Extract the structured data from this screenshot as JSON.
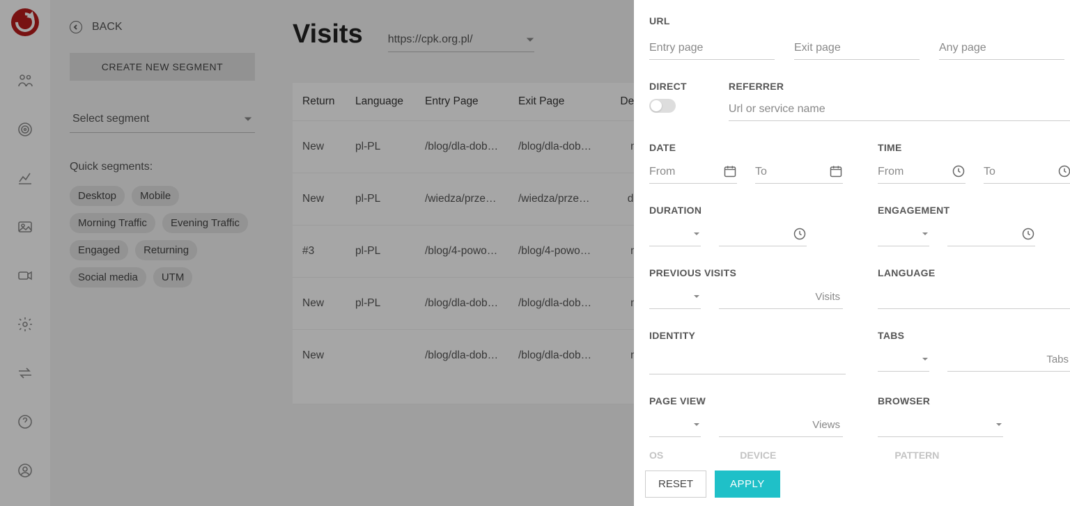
{
  "sidebar": {
    "back": "BACK",
    "create_segment": "CREATE NEW SEGMENT",
    "select_segment": "Select segment",
    "quick_segments_label": "Quick segments:",
    "chips": [
      "Desktop",
      "Mobile",
      "Morning Traffic",
      "Evening Traffic",
      "Engaged",
      "Returning",
      "Social media",
      "UTM"
    ]
  },
  "main": {
    "title": "Visits",
    "site": "https://cpk.org.pl/",
    "columns": [
      "Return",
      "Language",
      "Entry Page",
      "Exit Page",
      "Dev"
    ],
    "rows": [
      {
        "return": "New",
        "lang": "pl-PL",
        "entry": "/blog/dla-dob…",
        "exit": "/blog/dla-dob…",
        "dev": "m"
      },
      {
        "return": "New",
        "lang": "pl-PL",
        "entry": "/wiedza/prze…",
        "exit": "/wiedza/prze…",
        "dev": "de"
      },
      {
        "return": "#3",
        "lang": "pl-PL",
        "entry": "/blog/4-powo…",
        "exit": "/blog/4-powo…",
        "dev": "m"
      },
      {
        "return": "New",
        "lang": "pl-PL",
        "entry": "/blog/dla-dob…",
        "exit": "/blog/dla-dob…",
        "dev": "m"
      },
      {
        "return": "New",
        "lang": "",
        "entry": "/blog/dla-dob…",
        "exit": "/blog/dla-dob…",
        "dev": "m"
      }
    ]
  },
  "drawer": {
    "url_label": "URL",
    "entry_ph": "Entry page",
    "exit_ph": "Exit page",
    "any_ph": "Any page",
    "direct": "DIRECT",
    "referrer": "REFERRER",
    "referrer_ph": "Url or service name",
    "date": "DATE",
    "time": "TIME",
    "from": "From",
    "to": "To",
    "duration": "DURATION",
    "engagement": "ENGAGEMENT",
    "prev": "PREVIOUS VISITS",
    "visits_suffix": "Visits",
    "language": "LANGUAGE",
    "identity": "IDENTITY",
    "tabs": "TABS",
    "tabs_suffix": "Tabs",
    "pageview": "PAGE VIEW",
    "views_suffix": "Views",
    "browser": "BROWSER",
    "os": "OS",
    "device": "DEVICE",
    "pattern": "PATTERN",
    "reset": "RESET",
    "apply": "APPLY"
  }
}
